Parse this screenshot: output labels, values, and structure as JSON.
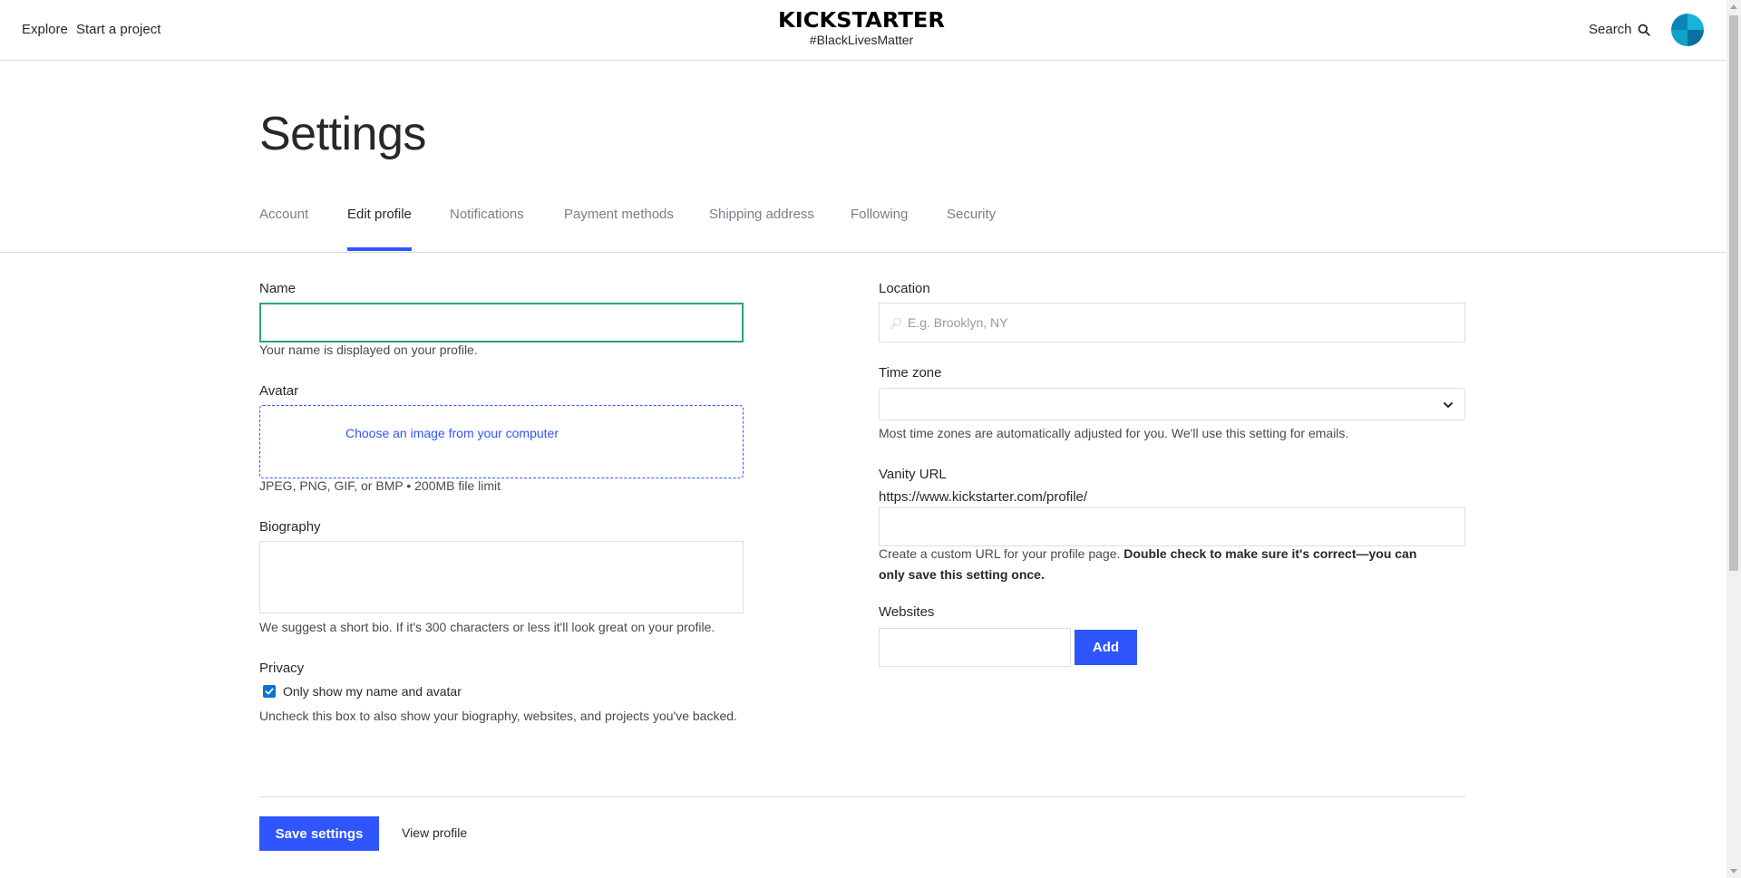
{
  "header": {
    "nav": [
      "Explore",
      "Start a project"
    ],
    "logo": "KICKSTARTER",
    "hashtag": "#BlackLivesMatter",
    "search_label": "Search",
    "search_icon": "search-icon",
    "avatar_icon": "user-avatar"
  },
  "page": {
    "title": "Settings",
    "tabs": [
      {
        "label": "Account"
      },
      {
        "label": "Edit profile",
        "active": true
      },
      {
        "label": "Notifications"
      },
      {
        "label": "Payment methods"
      },
      {
        "label": "Shipping address"
      },
      {
        "label": "Following"
      },
      {
        "label": "Security"
      }
    ]
  },
  "form": {
    "name": {
      "label": "Name",
      "value": "",
      "help": "Your name is displayed on your profile."
    },
    "avatar": {
      "label": "Avatar",
      "choose_label": "Choose an image from your computer",
      "help": "JPEG, PNG, GIF, or BMP • 200MB file limit"
    },
    "biography": {
      "label": "Biography",
      "value": "",
      "help": "We suggest a short bio. If it's 300 characters or less it'll look great on your profile."
    },
    "privacy": {
      "label": "Privacy",
      "checkbox_label": "Only show my name and avatar",
      "checked": true,
      "help": "Uncheck this box to also show your biography, websites, and projects you've backed."
    },
    "location": {
      "label": "Location",
      "placeholder": "E.g. Brooklyn, NY",
      "icon": "location-search-icon"
    },
    "timezone": {
      "label": "Time zone",
      "selected": "",
      "help": "Most time zones are automatically adjusted for you. We'll use this setting for emails."
    },
    "vanity_url": {
      "label": "Vanity URL",
      "prefix": "https://www.kickstarter.com/profile/",
      "value": "",
      "help_plain": "Create a custom URL for your profile page. ",
      "help_bold": "Double check to make sure it's correct—you can only save this setting once."
    },
    "websites": {
      "label": "Websites",
      "value": "",
      "add_label": "Add"
    }
  },
  "footer": {
    "save_label": "Save settings",
    "view_profile_label": "View profile"
  },
  "colors": {
    "accent": "#2f55ff",
    "focus": "#2aa386",
    "checkbox": "#0a74da"
  }
}
